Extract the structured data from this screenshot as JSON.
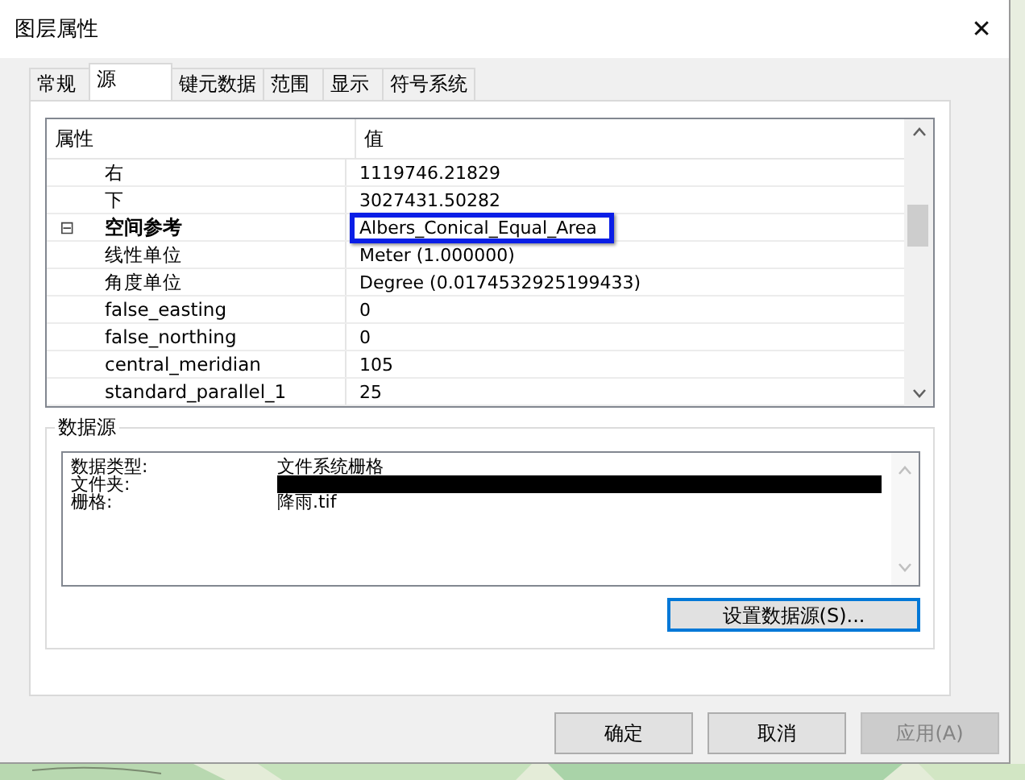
{
  "window": {
    "title": "图层属性",
    "close": "✕"
  },
  "tabs": [
    {
      "label": "常规",
      "selected": false
    },
    {
      "label": "源",
      "selected": true
    },
    {
      "label": "键元数据",
      "selected": false
    },
    {
      "label": "范围",
      "selected": false
    },
    {
      "label": "显示",
      "selected": false
    },
    {
      "label": "符号系统",
      "selected": false
    }
  ],
  "property_grid": {
    "columns": [
      "属性",
      "值"
    ],
    "rows": [
      {
        "children": [
          {
            "name": "右",
            "value": "1119746.21829"
          },
          {
            "name": "下",
            "value": "3027431.50282"
          }
        ]
      },
      {
        "name": "空间参考",
        "value": "Albers_Conical_Equal_Area",
        "expanded": true,
        "highlighted": true,
        "toggle": "⊟",
        "children": [
          {
            "name": "线性单位",
            "value": "Meter (1.000000)"
          },
          {
            "name": "角度单位",
            "value": "Degree (0.0174532925199433)"
          },
          {
            "name": "false_easting",
            "value": "0"
          },
          {
            "name": "false_northing",
            "value": "0"
          },
          {
            "name": "central_meridian",
            "value": "105"
          },
          {
            "name": "standard_parallel_1",
            "value": "25"
          }
        ]
      }
    ]
  },
  "data_source": {
    "title": "数据源",
    "lines": [
      {
        "label": "数据类型:",
        "value": "文件系统栅格",
        "redacted": false
      },
      {
        "label": "文件夹:",
        "redacted": true
      },
      {
        "label": "栅格:",
        "value": "降雨.tif",
        "redacted": false
      }
    ],
    "button": "设置数据源(S)..."
  },
  "buttons": [
    {
      "label": "确定",
      "disabled": false
    },
    {
      "label": "取消",
      "disabled": false
    },
    {
      "label": "应用(A)",
      "disabled": true
    }
  ]
}
